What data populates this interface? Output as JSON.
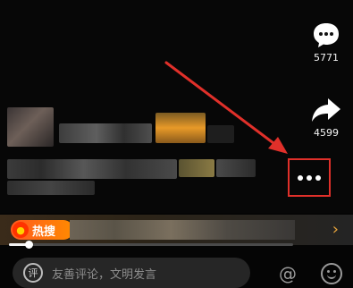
{
  "rail": {
    "comment_count": "5771",
    "share_count": "4599"
  },
  "hot": {
    "label": "热搜"
  },
  "playback": {
    "progress_fraction": 0.07
  },
  "comment_bar": {
    "placeholder": "友善评论，文明发言",
    "icon_char": "评"
  },
  "annotation": {
    "arrow_color": "#e0302a",
    "highlight_color": "#e0302a"
  }
}
